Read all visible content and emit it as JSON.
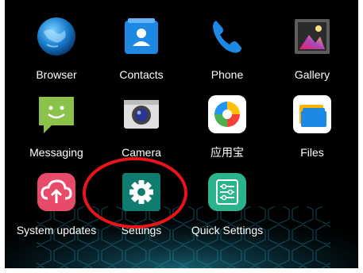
{
  "apps": [
    {
      "label": "Browser",
      "icon": "browser-globe-icon"
    },
    {
      "label": "Contacts",
      "icon": "contacts-icon"
    },
    {
      "label": "Phone",
      "icon": "phone-icon"
    },
    {
      "label": "Gallery",
      "icon": "gallery-icon"
    },
    {
      "label": "Messaging",
      "icon": "messaging-icon"
    },
    {
      "label": "Camera",
      "icon": "camera-icon"
    },
    {
      "label": "应用宝",
      "icon": "app-store-icon"
    },
    {
      "label": "Files",
      "icon": "files-icon"
    },
    {
      "label": "System updates",
      "icon": "system-updates-icon"
    },
    {
      "label": "Settings",
      "icon": "settings-gear-icon"
    },
    {
      "label": "Quick Settings",
      "icon": "quick-settings-icon"
    }
  ],
  "annotation": {
    "shape": "ellipse",
    "color": "#e8141a",
    "target": "Settings"
  },
  "colors": {
    "background": "#000000",
    "label_text": "#ffffff",
    "contacts": "#1e88e5",
    "phone": "#1e88e5",
    "messaging": "#8bc34a",
    "system_updates": "#e84a6a",
    "settings": "#0e7d6f",
    "quick_settings": "#2bb38e",
    "hex_glow": "#1fa3c7"
  }
}
